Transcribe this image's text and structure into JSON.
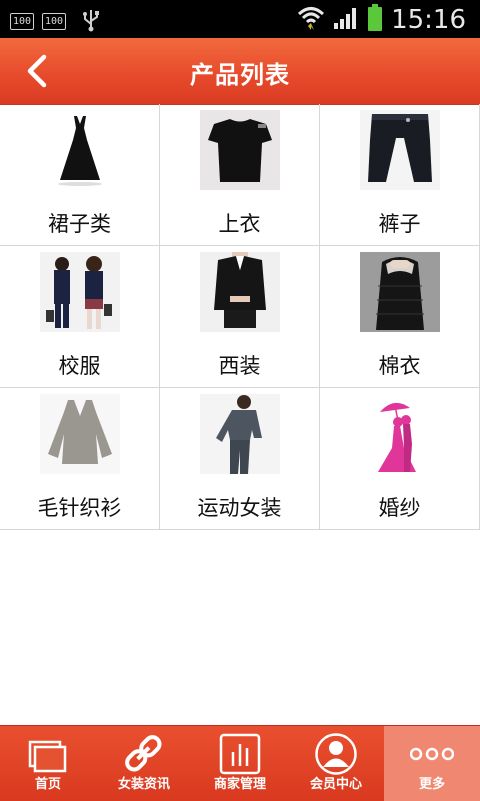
{
  "status_bar": {
    "notif1": "100",
    "notif2": "100",
    "time": "15:16"
  },
  "header": {
    "title": "产品列表"
  },
  "categories": [
    {
      "label": "裙子类",
      "icon": "dress-image"
    },
    {
      "label": "上衣",
      "icon": "tshirt-image"
    },
    {
      "label": "裤子",
      "icon": "pants-image"
    },
    {
      "label": "校服",
      "icon": "school-uniform-image"
    },
    {
      "label": "西装",
      "icon": "suit-image"
    },
    {
      "label": "棉衣",
      "icon": "padded-jacket-image"
    },
    {
      "label": "毛针织衫",
      "icon": "knit-sweater-image"
    },
    {
      "label": "运动女装",
      "icon": "sportswear-image"
    },
    {
      "label": "婚纱",
      "icon": "wedding-dress-image"
    }
  ],
  "tabs": [
    {
      "label": "首页",
      "icon": "home-icon"
    },
    {
      "label": "女装资讯",
      "icon": "link-icon"
    },
    {
      "label": "商家管理",
      "icon": "bar-chart-icon"
    },
    {
      "label": "会员中心",
      "icon": "user-icon"
    },
    {
      "label": "更多",
      "icon": "more-dots-icon"
    }
  ],
  "colors": {
    "header_accent": "#e6492a",
    "tab_active": "#f08770",
    "wedding_pink": "#e0369a"
  }
}
